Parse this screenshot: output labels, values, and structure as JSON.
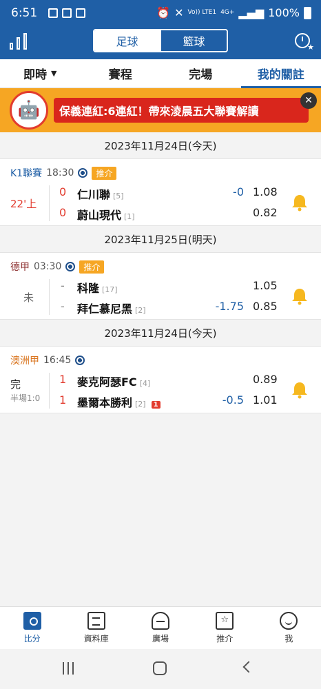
{
  "statusbar": {
    "time": "6:51",
    "battery": "100%",
    "signal_text": "Vo))\nLTE1",
    "network": "4G+"
  },
  "header": {
    "segments": {
      "football": "足球",
      "basketball": "籃球"
    }
  },
  "tabs": {
    "live": "即時",
    "schedule": "賽程",
    "finished": "完場",
    "favorites": "我的關註"
  },
  "banner": {
    "message": "保義連紅:6連紅！帶來淩晨五大聯賽解讀",
    "avatar_icon": "astro-boy-avatar"
  },
  "dates": {
    "d1": "2023年11月24日(今天)",
    "d2": "2023年11月25日(明天)",
    "d3": "2023年11月24日(今天)"
  },
  "matches": [
    {
      "league": "K1聯賽",
      "league_color": "#1f5fa6",
      "kickoff": "18:30",
      "tag": "推介",
      "status": "22'上",
      "status_color": "#e23b2e",
      "home": {
        "score": "0",
        "name": "仁川聯",
        "rank": "[5]"
      },
      "away": {
        "score": "0",
        "name": "蔚山現代",
        "rank": "[1]"
      },
      "home_handicap": "-0",
      "away_handicap": "",
      "home_odds": "1.08",
      "away_odds": "0.82"
    },
    {
      "league": "德甲",
      "league_color": "#8a2a2a",
      "kickoff": "03:30",
      "tag": "推介",
      "status": "未",
      "status_color": "#666",
      "home": {
        "score": "-",
        "name": "科隆",
        "rank": "[17]"
      },
      "away": {
        "score": "-",
        "name": "拜仁慕尼黑",
        "rank": "[2]"
      },
      "home_handicap": "",
      "away_handicap": "-1.75",
      "home_odds": "1.05",
      "away_odds": "0.85"
    },
    {
      "league": "澳洲甲",
      "league_color": "#d9731c",
      "kickoff": "16:45",
      "tag": "",
      "status": "完",
      "status_color": "#222",
      "half_score": "半場1:0",
      "home": {
        "score": "1",
        "name": "麥克阿瑟FC",
        "rank": "[4]"
      },
      "away": {
        "score": "1",
        "name": "墨爾本勝利",
        "rank": "[2]",
        "red_cards": "1"
      },
      "home_handicap": "",
      "away_handicap": "-0.5",
      "home_odds": "0.89",
      "away_odds": "1.01"
    }
  ],
  "bottom_nav": {
    "score": "比分",
    "database": "資料庫",
    "square": "廣場",
    "tips": "推介",
    "me": "我"
  },
  "colors": {
    "primary": "#1f5fa6",
    "accent": "#f6a623",
    "live_red": "#e23b2e",
    "bell": "#f6b81f"
  }
}
